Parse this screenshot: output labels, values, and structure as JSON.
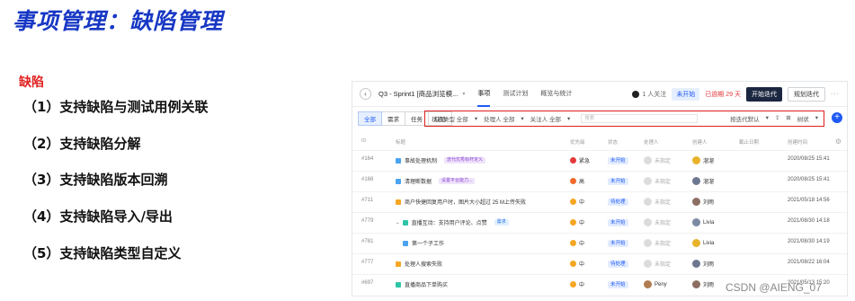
{
  "slide": {
    "title": "事项管理：缺陷管理",
    "section": "缺陷",
    "features": [
      "（1）支持缺陷与测试用例关联",
      "（2）支持缺陷分解",
      "（3）支持缺陷版本回溯",
      "（4）支持缺陷导入/导出",
      "（5）支持缺陷类型自定义"
    ]
  },
  "app": {
    "breadcrumb": "Q3 - Sprint1 [商品浏览模...",
    "tabs": [
      "事项",
      "测试计划",
      "概览与统计"
    ],
    "active_tab": "事项",
    "follow": "1 人关注",
    "status": "未开始",
    "overdue": "已逾期 29 天",
    "start_button": "开始迭代",
    "plan_button": "规划迭代",
    "type_filters": [
      "全部",
      "需求",
      "任务",
      "缺陷"
    ],
    "filters": {
      "status_type": "状态类型 全部",
      "handler": "处理人 全部",
      "follower": "关注人 全部",
      "search_placeholder": "搜索",
      "sort": "按迭代默认",
      "tree": "树状"
    },
    "columns": [
      "ID",
      "标题",
      "优先级",
      "状态",
      "处理人",
      "创建人",
      "截止日期",
      "创建时间"
    ],
    "rows": [
      {
        "id": "#164",
        "title": "事故处理机制",
        "tag": "迭代优秀标杆定义",
        "tag_color": "purple",
        "priority": "紧急",
        "priority_color": "#e5383b",
        "status": "未开始",
        "handler": "未指定",
        "creator": "溜溜",
        "created": "2020/08/25 15:41",
        "icon_color": "#4aa3f0"
      },
      {
        "id": "#168",
        "title": "清理断数据",
        "tag": "设置平台能力...",
        "tag_color": "purple",
        "priority": "高",
        "priority_color": "#f06a2a",
        "status": "未开始",
        "handler": "未指定",
        "creator": "溜溜",
        "created": "2020/08/25 15:41",
        "icon_color": "#4aa3f0"
      },
      {
        "id": "#711",
        "title": "商户快捷回复用户时，图片大小超过 25 M上传失败",
        "tag": "",
        "tag_color": "",
        "priority": "中",
        "priority_color": "#f5a623",
        "status": "待处理",
        "handler": "未指定",
        "creator": "刘雨",
        "created": "2021/05/18 14:56",
        "icon_color": "#f5a623"
      },
      {
        "id": "#779",
        "title": "直播互动：支持用户评论、点赞",
        "tag": "需求",
        "tag_color": "blue",
        "priority": "中",
        "priority_color": "#f5a623",
        "status": "未开始",
        "handler": "未指定",
        "creator": "Livia",
        "created": "2021/08/30 14:18",
        "icon_color": "#2ec5a7",
        "expand": true
      },
      {
        "id": "#781",
        "title": "第一个子工作",
        "tag": "",
        "tag_color": "",
        "priority": "中",
        "priority_color": "#f5a623",
        "status": "未开始",
        "handler": "未指定",
        "creator": "Livia",
        "created": "2021/08/30 14:19",
        "icon_color": "#4aa3f0",
        "indent": true
      },
      {
        "id": "#777",
        "title": "处理人搜索失败",
        "tag": "",
        "tag_color": "",
        "priority": "中",
        "priority_color": "#f5a623",
        "status": "待处理",
        "handler": "未指定",
        "creator": "刘雨",
        "created": "2021/08/22 16:04",
        "icon_color": "#f5a623"
      },
      {
        "id": "#697",
        "title": "直播商品下单购买",
        "tag": "",
        "tag_color": "",
        "priority": "中",
        "priority_color": "#f5a623",
        "status": "未开始",
        "handler": "Peny",
        "creator": "刘雨",
        "created": "2021/05/13 15:20",
        "icon_color": "#2ec5a7"
      }
    ]
  },
  "watermark": "CSDN @AIENG_07"
}
